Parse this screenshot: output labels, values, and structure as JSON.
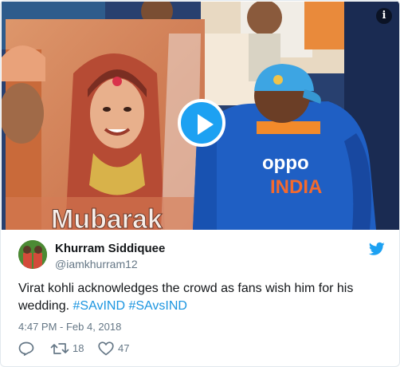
{
  "tweet": {
    "author_name": "Khurram Siddiquee",
    "author_handle": "@iamkhurram12",
    "text_plain": "Virat kohli acknowledges the crowd as fans wish him for his wedding.",
    "hashtags": [
      "#SAvIND",
      "#SAvsIND"
    ],
    "timestamp": "4:47 PM - Feb 4, 2018",
    "retweet_count": "18",
    "like_count": "47"
  },
  "media": {
    "info_label": "i",
    "banner_text": "Mubarak",
    "jersey_brand": "oppo",
    "jersey_team": "INDIA"
  },
  "icons": {
    "play": "play-icon",
    "info": "info-icon",
    "bird": "twitter-bird-icon",
    "reply": "reply-icon",
    "retweet": "retweet-icon",
    "like": "heart-icon"
  },
  "colors": {
    "accent": "#1da1f2",
    "hashtag": "#1b95e0",
    "muted": "#657786",
    "text": "#14171a"
  }
}
